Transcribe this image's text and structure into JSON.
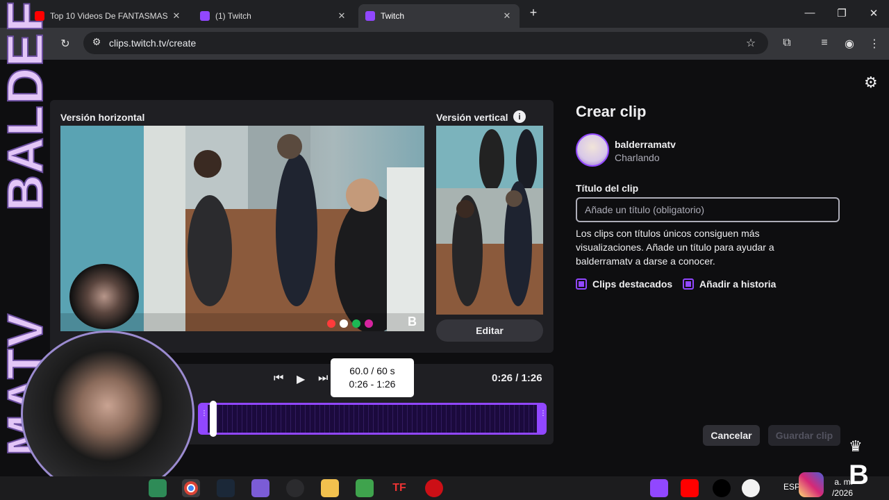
{
  "browser": {
    "tabs": [
      {
        "title": "Top 10 Videos De FANTASMAS",
        "active": false
      },
      {
        "title": "(1) Twitch",
        "active": false
      },
      {
        "title": "Twitch",
        "active": true
      }
    ],
    "new_tab": "+",
    "url": "clips.twitch.tv/create"
  },
  "editor": {
    "horizontal_label": "Versión horizontal",
    "vertical_label": "Versión vertical",
    "info": "i",
    "edit_button": "Editar",
    "tooltip_duration": "60.0 / 60 s",
    "tooltip_range": "0:26 - 1:26",
    "time": "0:26 / 1:26"
  },
  "panel": {
    "title": "Crear clip",
    "channel": "balderramatv",
    "category": "Charlando",
    "title_label": "Título del clip",
    "title_placeholder": "Añade un título (obligatorio)",
    "hint": "Los clips con títulos únicos consiguen más visualizaciones. Añade un título para ayudar a balderramatv a darse a conocer.",
    "checkbox_featured": "Clips destacados",
    "checkbox_story": "Añadir a historia",
    "cancel": "Cancelar",
    "save": "Guardar clip"
  },
  "overlay": {
    "side_top": "BALDEF",
    "side_bottom": "MATV",
    "brand_letter": "B"
  },
  "taskbar": {
    "language": "ESP",
    "time": "a. m.",
    "date": "/2026"
  },
  "colors": {
    "accent": "#9147ff",
    "background": "#0e0e10",
    "card": "#1f1f23"
  },
  "icons": [
    "reload-icon",
    "site-settings-icon",
    "bookmark-star-icon",
    "extensions-icon",
    "media-icon",
    "profile-icon",
    "menu-icon",
    "settings-gear-icon",
    "info-icon",
    "skip-back-icon",
    "play-icon",
    "skip-forward-icon",
    "crown-icon"
  ]
}
